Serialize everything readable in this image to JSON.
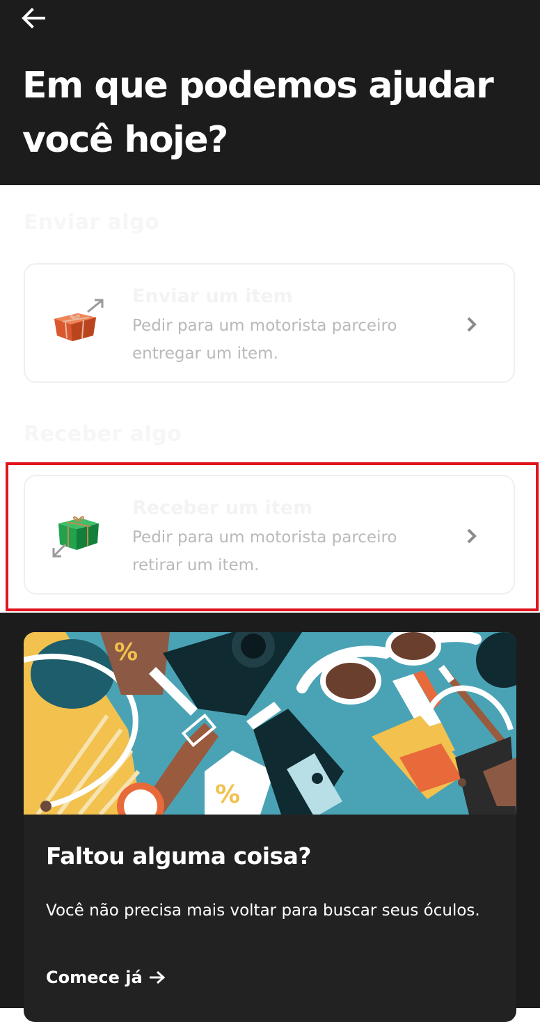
{
  "header": {
    "back_icon": "arrow-left-icon",
    "title": "Em que podemos ajudar você hoje?"
  },
  "sections": [
    {
      "label": "Enviar algo",
      "card": {
        "icon": "gift-box-orange-send-icon",
        "title": "Enviar um item",
        "description": "Pedir para um motorista parceiro entregar um item."
      }
    },
    {
      "label": "Receber algo",
      "card": {
        "icon": "gift-box-green-receive-icon",
        "title": "Receber um item",
        "description": "Pedir para um motorista parceiro retirar um item."
      }
    }
  ],
  "promo": {
    "title": "Faltou alguma coisa?",
    "text": "Você não precisa mais voltar para buscar seus óculos.",
    "cta": "Comece já"
  },
  "colors": {
    "header_bg": "#1c1c1c",
    "highlight": "#e1141d",
    "desc_text": "#b9b9b9",
    "promo_bg": "#222222",
    "illustration_bg": "#4aa3b5"
  }
}
